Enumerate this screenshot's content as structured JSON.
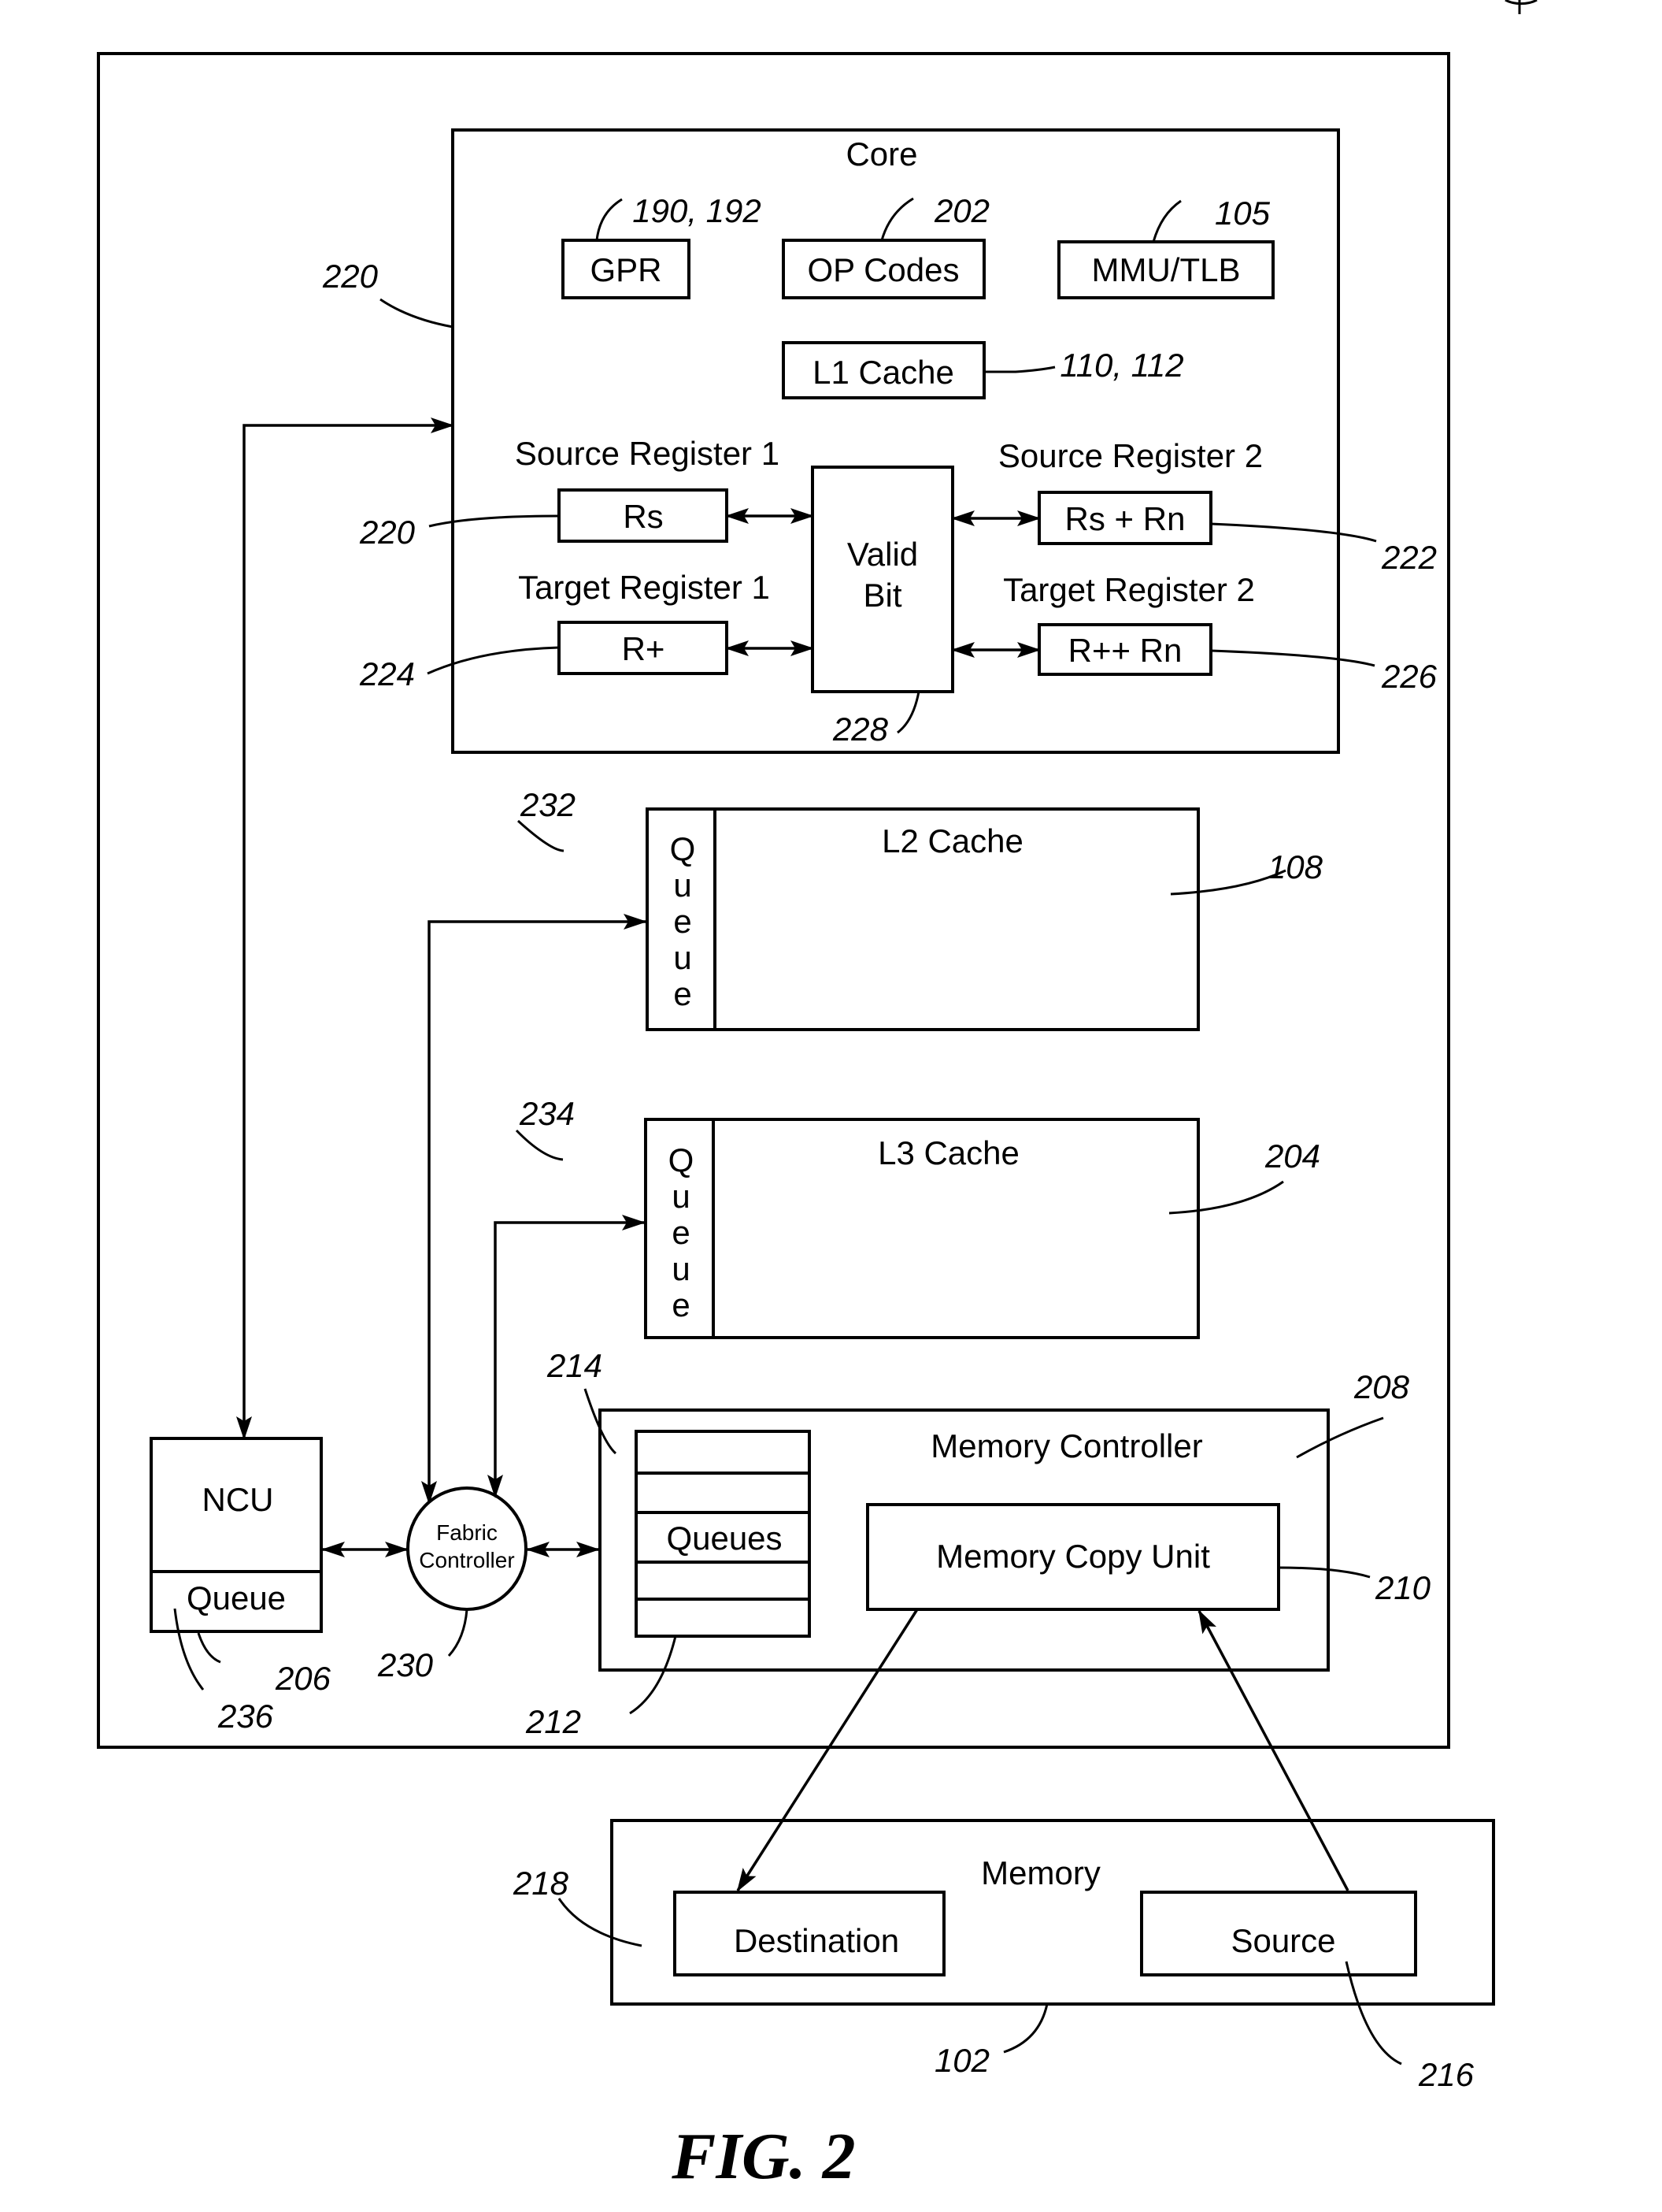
{
  "figure": {
    "caption": "FIG. 2"
  },
  "core": {
    "title": "Core",
    "ref": "220",
    "gpr": {
      "label": "GPR",
      "ref": "190, 192"
    },
    "op_codes": {
      "label": "OP Codes",
      "ref": "202"
    },
    "mmu": {
      "label": "MMU/TLB",
      "ref": "105"
    },
    "l1": {
      "label": "L1 Cache",
      "ref": "110, 112"
    },
    "source_reg1": {
      "title": "Source Register 1",
      "label": "Rs",
      "ref": "220"
    },
    "source_reg2": {
      "title": "Source Register 2",
      "label": "Rs + Rn",
      "ref": "222"
    },
    "target_reg1": {
      "title": "Target Register 1",
      "label": "R+",
      "ref": "224"
    },
    "target_reg2": {
      "title": "Target Register 2",
      "label": "R++ Rn",
      "ref": "226"
    },
    "valid_bit": {
      "line1": "Valid",
      "line2": "Bit",
      "ref": "228"
    }
  },
  "l2": {
    "label": "L2 Cache",
    "ref": "108",
    "queue_ref": "232",
    "queue_letters": [
      "Q",
      "u",
      "e",
      "u",
      "e"
    ]
  },
  "l3": {
    "label": "L3 Cache",
    "ref": "204",
    "queue_ref": "234",
    "queue_letters": [
      "Q",
      "u",
      "e",
      "u",
      "e"
    ]
  },
  "ncu": {
    "label": "NCU",
    "queue_label": "Queue",
    "ref": "206",
    "queue_ref": "236"
  },
  "fabric": {
    "line1": "Fabric",
    "line2": "Controller",
    "ref": "230"
  },
  "memory_controller": {
    "label": "Memory Controller",
    "ref": "208",
    "queues_label": "Queues",
    "queues_ref": "212",
    "queue_entry_ref": "214",
    "copy_unit": {
      "label": "Memory Copy Unit",
      "ref": "210"
    }
  },
  "memory": {
    "label": "Memory",
    "ref": "102",
    "destination": {
      "label": "Destination",
      "ref": "218"
    },
    "source": {
      "label": "Source",
      "ref": "216"
    }
  }
}
